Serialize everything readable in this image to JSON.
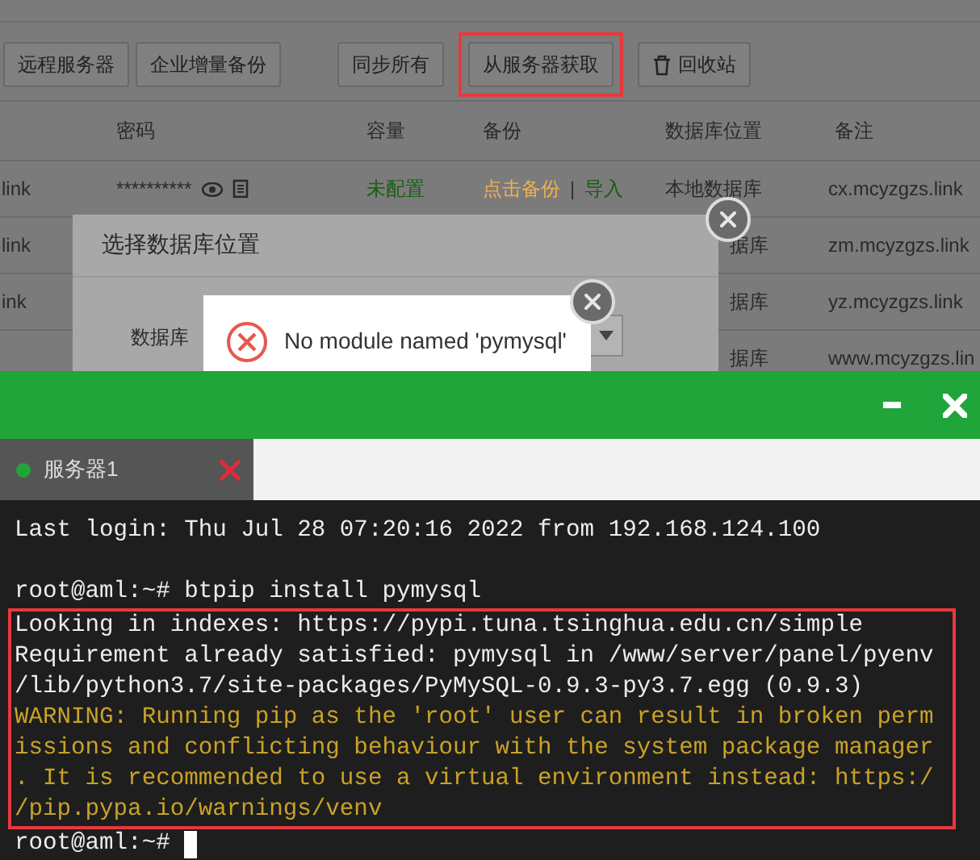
{
  "toolbar": {
    "buttons": [
      {
        "label": "远程服务器",
        "kind": "text"
      },
      {
        "label": "企业增量备份",
        "kind": "text"
      },
      {
        "label": "同步所有",
        "kind": "text"
      }
    ],
    "highlighted_buttons": [
      {
        "label": "从服务器获取",
        "kind": "text"
      }
    ],
    "buttons_after": [
      {
        "label": "回收站",
        "kind": "icon"
      }
    ]
  },
  "table": {
    "columns": [
      "密码",
      "容量",
      "备份",
      "数据库位置",
      "备注"
    ],
    "rows": [
      {
        "column_1": "link",
        "password": "**********",
        "capacity": "未配置",
        "backup": "点击备份",
        "separator": "|",
        "import": "导入",
        "location": "本地数据库",
        "note": "cx.mcyzgzs.link"
      },
      {
        "column_1": "link",
        "location": "据库",
        "note": "zm.mcyzgzs.link"
      },
      {
        "column_1": "ink",
        "location": "据库",
        "note": "yz.mcyzgzs.link"
      },
      {
        "location": "据库",
        "note": "www.mcyzgzs.lin"
      }
    ]
  },
  "dialog": {
    "title": "选择数据库位置",
    "field_label": "数据库"
  },
  "toast": {
    "message": "No module named 'pymysql'"
  },
  "terminal_window": {
    "tabs": [
      {
        "label": "服务器1",
        "selected": true,
        "connected": true
      }
    ],
    "lines_before": [
      {
        "text": "Last login: Thu Jul 28 07:20:16 2022 from 192.168.124.100",
        "kind": "normal"
      },
      {
        "kind": "blank"
      },
      {
        "text": "root@aml:~# btpip install pymysql",
        "kind": "normal"
      }
    ],
    "highlighted_output": [
      {
        "text": "Looking in indexes: https://pypi.tuna.tsinghua.edu.cn/simple",
        "kind": "normal"
      },
      {
        "text": "Requirement already satisfied: pymysql in /www/server/panel/pyenv",
        "kind": "normal"
      },
      {
        "text": "/lib/python3.7/site-packages/PyMySQL-0.9.3-py3.7.egg (0.9.3)",
        "kind": "normal"
      },
      {
        "text": "WARNING: Running pip as the 'root' user can result in broken perm",
        "kind": "warning"
      },
      {
        "text": "issions and conflicting behaviour with the system package manager",
        "kind": "warning"
      },
      {
        "text": ". It is recommended to use a virtual environment instead: https:/",
        "kind": "warning"
      },
      {
        "text": "/pip.pypa.io/warnings/venv",
        "kind": "warning"
      }
    ],
    "lines_after": [
      {
        "text": "root@aml:~#",
        "kind": "prompt"
      }
    ]
  }
}
